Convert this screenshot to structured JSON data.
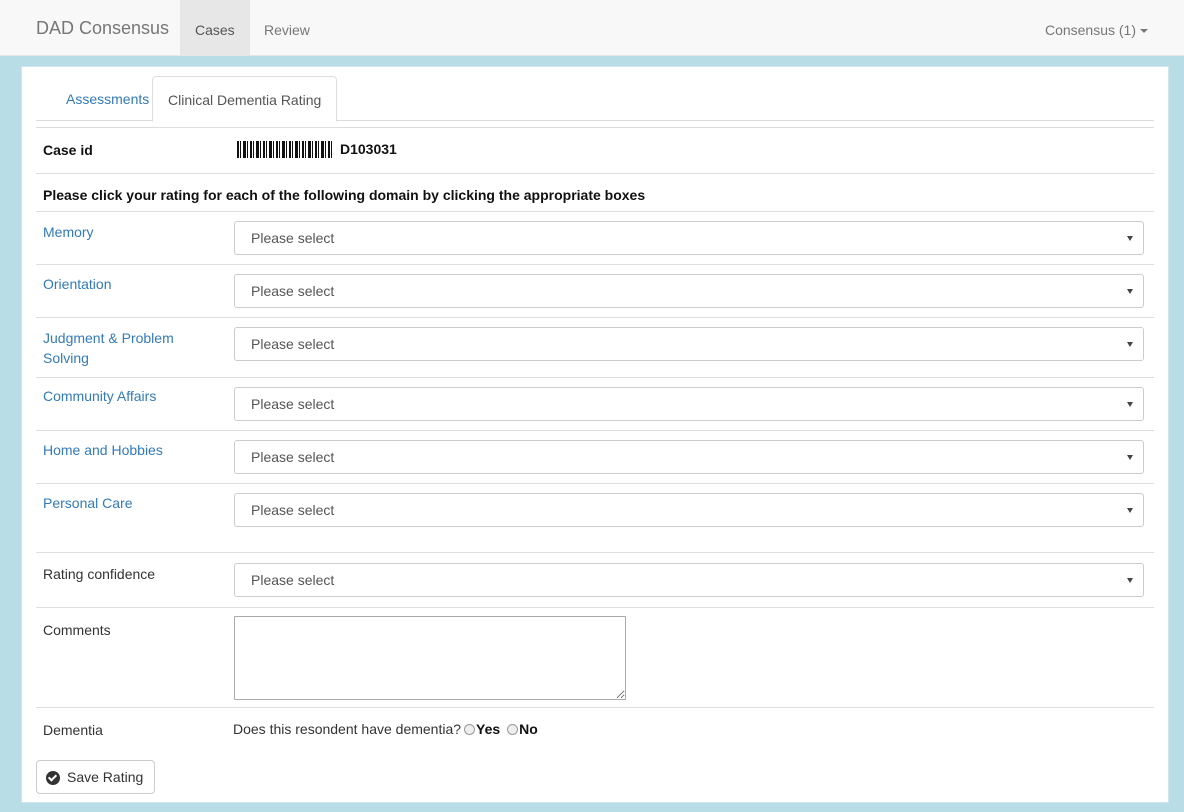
{
  "navbar": {
    "brand": "DAD Consensus",
    "links": [
      {
        "label": "Cases"
      },
      {
        "label": "Review"
      }
    ],
    "user_menu": "Consensus (1)"
  },
  "tabs": [
    {
      "label": "Assessments"
    },
    {
      "label": "Clinical Dementia Rating"
    }
  ],
  "case": {
    "label": "Case id",
    "value": "D103031"
  },
  "instructions": "Please click your rating for each of the following domain by clicking the appropriate boxes",
  "domains": [
    {
      "label": "Memory",
      "value": "Please select"
    },
    {
      "label": "Orientation",
      "value": "Please select"
    },
    {
      "label": "Judgment & Problem Solving",
      "value": "Please select"
    },
    {
      "label": "Community Affairs",
      "value": "Please select"
    },
    {
      "label": "Home and Hobbies",
      "value": "Please select"
    },
    {
      "label": "Personal Care",
      "value": "Please select"
    }
  ],
  "confidence": {
    "label": "Rating confidence",
    "value": "Please select"
  },
  "comments": {
    "label": "Comments",
    "value": ""
  },
  "dementia": {
    "label": "Dementia",
    "question": "Does this resondent have dementia?",
    "yes": "Yes",
    "no": "No"
  },
  "save_button": "Save Rating",
  "colors": {
    "link": "#337ab7",
    "frame": "#b9dde6",
    "navbar": "#f8f8f8"
  }
}
